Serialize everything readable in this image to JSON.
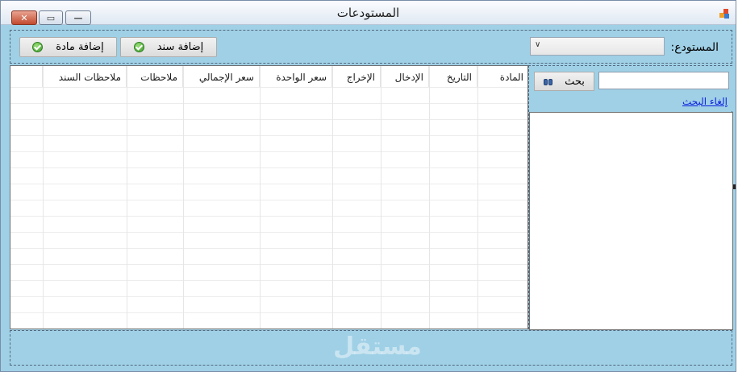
{
  "window": {
    "title": "المستودعات",
    "controls": {
      "close": "✕",
      "maximize": "▭",
      "minimize": "—"
    }
  },
  "toolbar": {
    "warehouse_label": "المستودع:",
    "warehouse_selected": "",
    "add_material": "إضافة مادة",
    "add_voucher": "إضافة سند"
  },
  "grid": {
    "columns": [
      "المادة",
      "التاريخ",
      "الإدخال",
      "الإخراج",
      "سعر الواحدة",
      "سعر الإجمالي",
      "ملاحظات",
      "ملاحظات السند"
    ],
    "rows": []
  },
  "search": {
    "value": "",
    "button": "بحث",
    "cancel": "إلغاء البحث"
  },
  "watermark": "مستقل",
  "colors": {
    "panel": "#9fd0e6",
    "link": "#0a1fe0",
    "check": "#3a9a2a"
  }
}
